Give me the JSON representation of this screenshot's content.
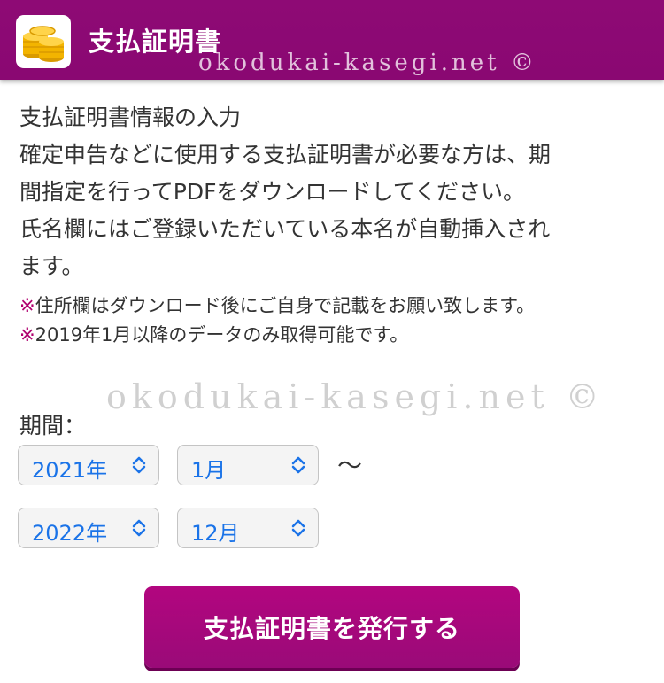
{
  "header": {
    "title": "支払証明書",
    "icon": "gold-coins-icon"
  },
  "watermark": {
    "text": "okodukai-kasegi.net ©"
  },
  "info": {
    "lines": [
      "支払証明書情報の入力",
      "確定申告などに使用する支払証明書が必要な方は、期",
      "間指定を行ってPDFをダウンロードしてください。",
      "氏名欄にはご登録いただいている本名が自動挿入され",
      "ます。"
    ]
  },
  "notes": [
    {
      "mark": "※",
      "text": "住所欄はダウンロード後にご自身で記載をお願い致します。"
    },
    {
      "mark": "※",
      "text": "2019年1月以降のデータのみ取得可能です。"
    }
  ],
  "period": {
    "label": "期間：",
    "from": {
      "year": "2021年",
      "month": "1月"
    },
    "separator": "〜",
    "to": {
      "year": "2022年",
      "month": "12月"
    }
  },
  "actions": {
    "issue_label": "支払証明書を発行する"
  },
  "colors": {
    "header": "#8e0a75",
    "button": "#a8087c",
    "note_mark": "#b0006f",
    "select_text": "#1a73e8"
  }
}
